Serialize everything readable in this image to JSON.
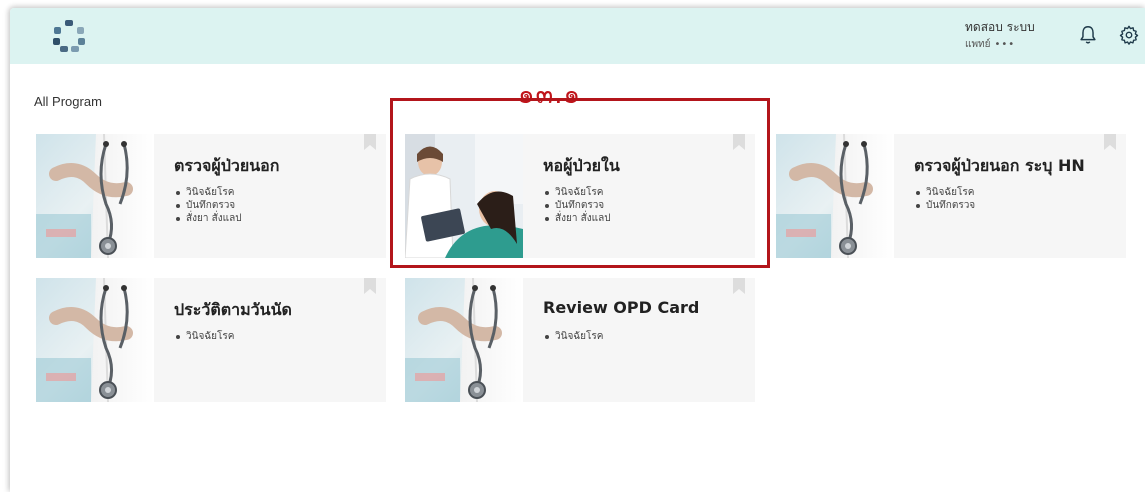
{
  "header": {
    "user_name": "ทดสอบ ระบบ",
    "user_role": "แพทย์",
    "user_role_more": "•••"
  },
  "annotation": "๑๓.๑",
  "section_title": "All Program",
  "programs": [
    {
      "title": "ตรวจผู้ป่วยนอก",
      "features": [
        "วินิจฉัยโรค",
        "บันทึกตรวจ",
        "สั่งยา สั่งแลป"
      ]
    },
    {
      "title": "หอผู้ป่วยใน",
      "features": [
        "วินิจฉัยโรค",
        "บันทึกตรวจ",
        "สั่งยา สั่งแลป"
      ]
    },
    {
      "title": "ตรวจผู้ป่วยนอก ระบุ HN",
      "features": [
        "วินิจฉัยโรค",
        "บันทึกตรวจ"
      ]
    },
    {
      "title": "ประวัติตามวันนัด",
      "features": [
        "วินิจฉัยโรค"
      ]
    },
    {
      "title": "Review OPD Card",
      "features": [
        "วินิจฉัยโรค"
      ]
    }
  ],
  "colors": {
    "topbar": "#dcf3f1",
    "annotation_red": "#b3151b",
    "card_bg": "#f6f6f6"
  },
  "icons": {
    "logo": "app-logo",
    "notifications": "bell-icon",
    "settings": "gear-icon",
    "bookmark": "bookmark-icon"
  }
}
